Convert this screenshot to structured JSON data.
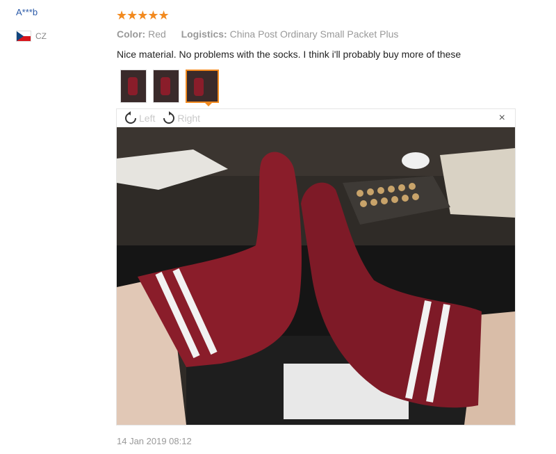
{
  "review": {
    "user": "A***b",
    "country": "CZ",
    "rating_stars": "★★★★★",
    "color_label": "Color:",
    "color_value": "Red",
    "logistics_label": "Logistics:",
    "logistics_value": "China Post Ordinary Small Packet Plus",
    "comment": "Nice material. No problems with the socks. I think i'll probably buy more of these",
    "date": "14 Jan 2019 08:12"
  },
  "viewer": {
    "rotate_left_label": "Left",
    "rotate_right_label": "Right",
    "close_symbol": "×"
  },
  "colors": {
    "link_blue": "#2b5aa8",
    "star_orange": "#f28a1f",
    "sock_red": "#8a1d2a"
  }
}
